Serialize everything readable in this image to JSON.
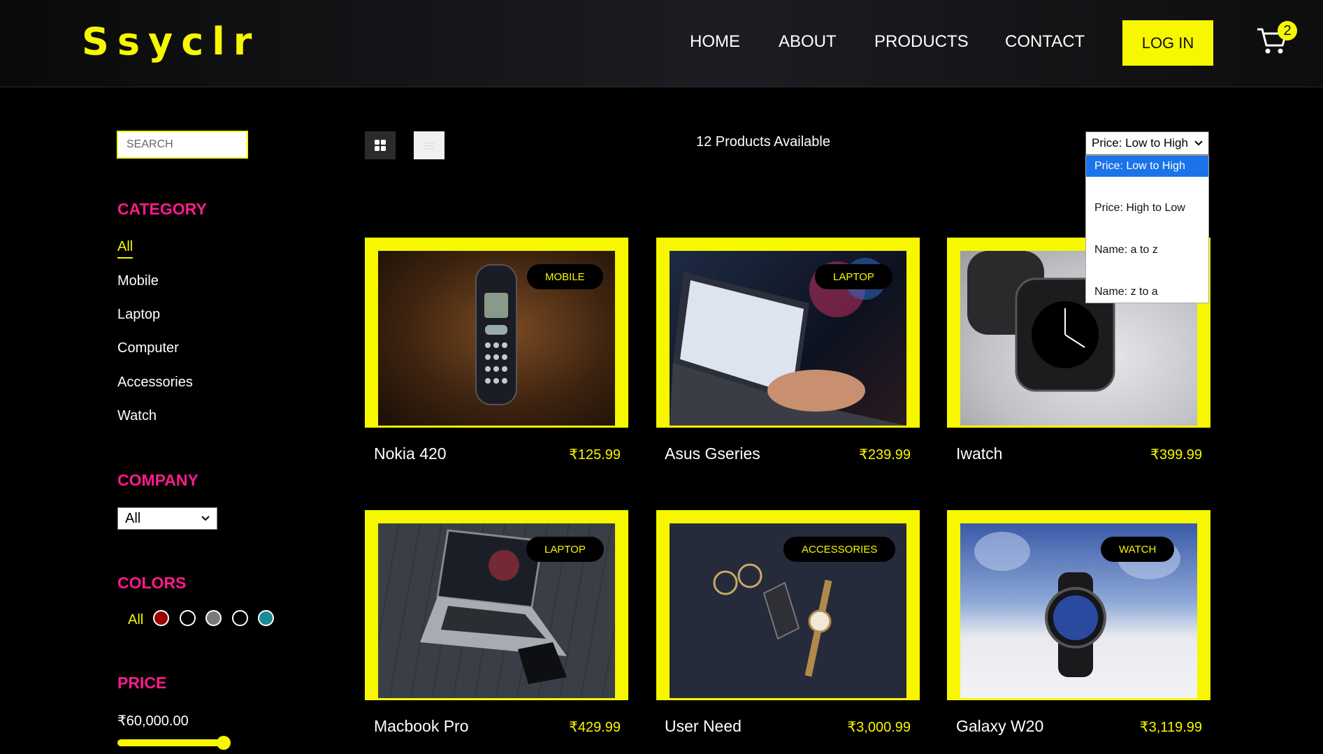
{
  "header": {
    "logo": "Ssyclr",
    "nav": [
      "HOME",
      "ABOUT",
      "PRODUCTS",
      "CONTACT"
    ],
    "login": "LOG IN",
    "cart_count": "2"
  },
  "sidebar": {
    "search_placeholder": "SEARCH",
    "category_heading": "CATEGORY",
    "categories": [
      "All",
      "Mobile",
      "Laptop",
      "Computer",
      "Accessories",
      "Watch"
    ],
    "active_category": "All",
    "company_heading": "COMPANY",
    "company_selected": "All",
    "colors_heading": "COLORS",
    "colors_all": "All",
    "colors": [
      "#9b0000",
      "#000000",
      "#7a7a7a",
      "#000000",
      "#1a8a94"
    ],
    "price_heading": "PRICE",
    "price_value": "₹60,000.00",
    "price_slider_fraction": 1.0
  },
  "toolbar": {
    "grid_icon": "grid-icon",
    "list_icon": "list-icon",
    "product_count": "12 Products Available",
    "sort_selected": "Price: Low to High",
    "sort_options": [
      "Price: Low to High",
      "Price: High to Low",
      "Name: a to z",
      "Name: z to a"
    ]
  },
  "products": [
    {
      "name": "Nokia 420",
      "price": "₹125.99",
      "badge": "MOBILE"
    },
    {
      "name": "Asus Gseries",
      "price": "₹239.99",
      "badge": "LAPTOP"
    },
    {
      "name": "Iwatch",
      "price": "₹399.99",
      "badge": ""
    },
    {
      "name": "Macbook Pro",
      "price": "₹429.99",
      "badge": "LAPTOP"
    },
    {
      "name": "User Need",
      "price": "₹3,000.99",
      "badge": "ACCESSORIES"
    },
    {
      "name": "Galaxy W20",
      "price": "₹3,119.99",
      "badge": "WATCH"
    }
  ],
  "colors": {
    "accent": "#f7f700",
    "heading": "#ff1a8c",
    "background": "#000000"
  }
}
